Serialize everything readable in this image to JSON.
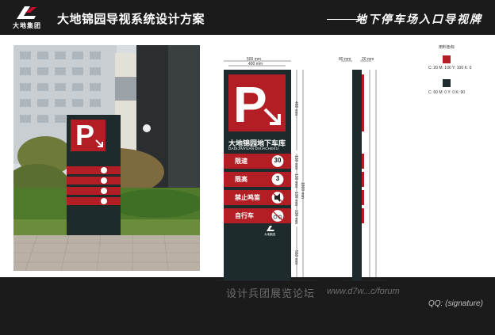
{
  "header": {
    "logo_text": "大地集团",
    "title": "大地锦园导视系统设计方案",
    "subtitle": "地下停车场入口导视牌"
  },
  "sign": {
    "name_cn": "大地锦园地下车库",
    "name_pinyin": "DADIJINYUAN DIXIACHEKU",
    "rows": [
      {
        "label": "限速",
        "badge": "30"
      },
      {
        "label": "限高",
        "badge": "3"
      },
      {
        "label": "禁止鸣笛",
        "badge": ""
      },
      {
        "label": "自行车",
        "badge": ""
      }
    ],
    "small_logo": "大地集团"
  },
  "dims": {
    "width_outer": "500 mm",
    "width_inner": "400 mm",
    "p_height": "480 mm",
    "row_h1": "130 mm",
    "row_h2": "130 mm",
    "row_h3": "130 mm",
    "row_h4": "130 mm",
    "bottom_h": "550 mm",
    "total_h": "1800 mm",
    "side_w1": "80 mm",
    "side_w2": "20 mm"
  },
  "legend": {
    "title": "用料色标",
    "red_cmyk": "C: 20   M: 100  Y: 100  K: 0",
    "dark_cmyk": "C: 60   M: 0   Y: 0   K: 90",
    "red": "#b31d24",
    "dark": "#1d2b2d"
  },
  "watermark": {
    "text": "设计兵团展览论坛",
    "url": "www.d7w...c/forum",
    "signature": "QQ: (signature)"
  }
}
